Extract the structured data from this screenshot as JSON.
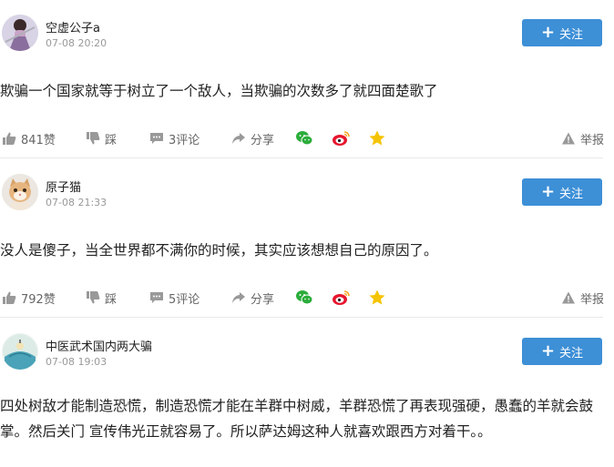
{
  "comments": [
    {
      "username": "空虚公子a",
      "time": "07-08 20:20",
      "follow_label": "关注",
      "text": "欺骗一个国家就等于树立了一个敌人，当欺骗的次数多了就四面楚歌了",
      "likes": "841赞",
      "dislike_label": "踩",
      "comments_label": "3评论",
      "share_label": "分享",
      "report_label": "举报"
    },
    {
      "username": "原子猫",
      "time": "07-08 21:33",
      "follow_label": "关注",
      "text": "没人是傻子，当全世界都不满你的时候，其实应该想想自己的原因了。",
      "likes": "792赞",
      "dislike_label": "踩",
      "comments_label": "5评论",
      "share_label": "分享",
      "report_label": "举报"
    },
    {
      "username": "中医武术国内两大骗",
      "time": "07-08 19:03",
      "follow_label": "关注",
      "text": "四处树敌才能制造恐慌，制造恐慌才能在羊群中树威，羊群恐慌了再表现强硬，愚蠢的羊就会鼓掌。然后关门 宣传伟光正就容易了。所以萨达姆这种人就喜欢跟西方对着干。。"
    }
  ],
  "colors": {
    "follow_button": "#3d8fd6",
    "wechat": "#2bad3b",
    "weibo": "#e6162d",
    "favorite": "#f5c400",
    "secondary_text": "#999999"
  },
  "icons": {
    "like": "thumbs-up-icon",
    "dislike": "thumbs-down-icon",
    "comment": "comment-bubble-icon",
    "share": "share-arrow-icon",
    "wechat": "wechat-icon",
    "weibo": "weibo-icon",
    "favorite": "star-icon",
    "report": "warning-triangle-icon"
  }
}
